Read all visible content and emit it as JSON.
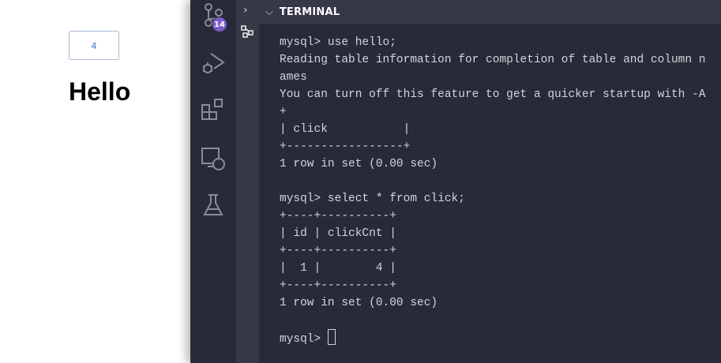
{
  "page": {
    "counter_value": "4",
    "heading": "Hello"
  },
  "activity_bar": {
    "source_control_badge": "14",
    "items": [
      "source-control",
      "run-and-debug",
      "extensions",
      "remote-explorer",
      "testing"
    ]
  },
  "panel": {
    "title": "TERMINAL"
  },
  "terminal": {
    "lines": [
      "mysql> use hello;",
      "Reading table information for completion of table and column n",
      "ames",
      "You can turn off this feature to get a quicker startup with -A",
      "+",
      "| click           |",
      "+-----------------+",
      "1 row in set (0.00 sec)",
      "",
      "mysql> select * from click;",
      "+----+----------+",
      "| id | clickCnt |",
      "+----+----------+",
      "|  1 |        4 |",
      "+----+----------+",
      "1 row in set (0.00 sec)",
      "",
      "mysql> "
    ]
  }
}
